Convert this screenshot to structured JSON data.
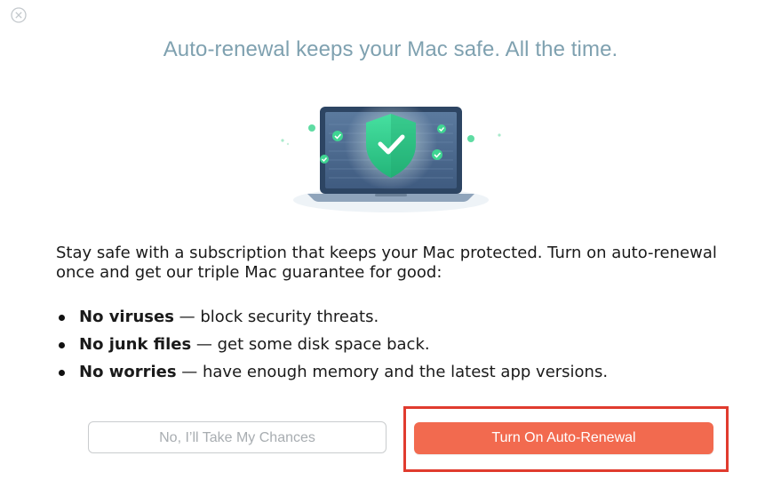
{
  "dialog": {
    "close_icon": "close-circle-icon",
    "headline": "Auto-renewal keeps your Mac safe. All the time.",
    "hero_icon": "laptop-shield-icon",
    "intro": "Stay safe with a subscription that keeps your Mac protected. Turn on auto-renewal once and get our triple Mac guarantee for good:",
    "features": [
      {
        "title": "No viruses",
        "text": " — block security threats."
      },
      {
        "title": "No junk files",
        "text": " — get some disk space back."
      },
      {
        "title": "No worries",
        "text": " — have enough memory and the latest app versions."
      }
    ],
    "decline_label": "No, I’ll Take My Chances",
    "accept_label": "Turn On Auto-Renewal"
  },
  "colors": {
    "headline": "#7fa1b0",
    "accent": "#f26a4f",
    "highlight_frame": "#e03b2e",
    "shield": "#37d48f"
  }
}
